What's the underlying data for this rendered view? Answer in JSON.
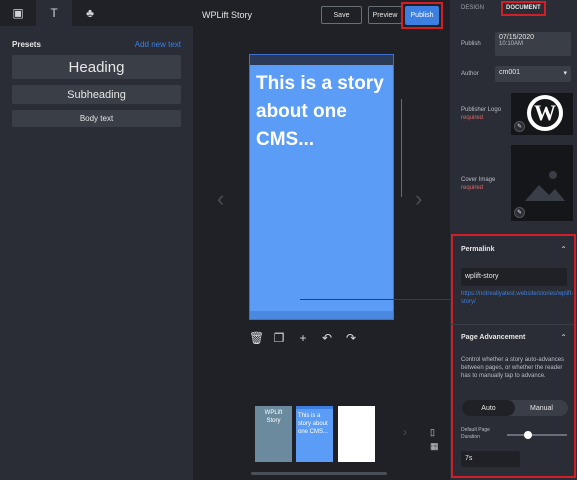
{
  "left": {
    "tabs": [
      {
        "icon": "image-icon",
        "glyph": "▣"
      },
      {
        "icon": "text-icon",
        "glyph": "T"
      },
      {
        "icon": "shapes-icon",
        "glyph": "♣"
      }
    ],
    "presets_label": "Presets",
    "add_new_text": "Add new text",
    "presets": [
      "Heading",
      "Subheading",
      "Body text"
    ]
  },
  "center": {
    "title": "WPLift Story",
    "save_label": "Save",
    "preview_label": "Preview",
    "publish_label": "Publish",
    "story_text": "This is a story about one CMS...",
    "thumbnails": [
      {
        "text": "WPLift Story"
      },
      {
        "text": "This is a story about one CMS..."
      },
      {
        "text": ""
      }
    ]
  },
  "right": {
    "tab_design": "DESIGN",
    "tab_document": "DOCUMENT",
    "publish_label": "Publish",
    "publish_date": "07/15/2020",
    "publish_time": "10:10AM",
    "author_label": "Author",
    "author_value": "cm001",
    "publisher_logo_label": "Publisher Logo",
    "publisher_logo_required": "required",
    "cover_image_label": "Cover Image",
    "cover_image_required": "required",
    "permalink_title": "Permalink",
    "permalink_value": "wplift-story",
    "permalink_url": "https://notreallyatest.website/stories/wplift-story/",
    "advancement_title": "Page Advancement",
    "advancement_desc": "Control whether a story auto-advances between pages, or whether the reader has to manually tap to advance.",
    "toggle_auto": "Auto",
    "toggle_manual": "Manual",
    "duration_label": "Default Page Duration",
    "duration_value": "7s",
    "duration_slider_fraction": 0.35
  },
  "colors": {
    "accent": "#3d7fe0",
    "highlight": "#d01f26",
    "story_bg": "#5b9df6"
  }
}
